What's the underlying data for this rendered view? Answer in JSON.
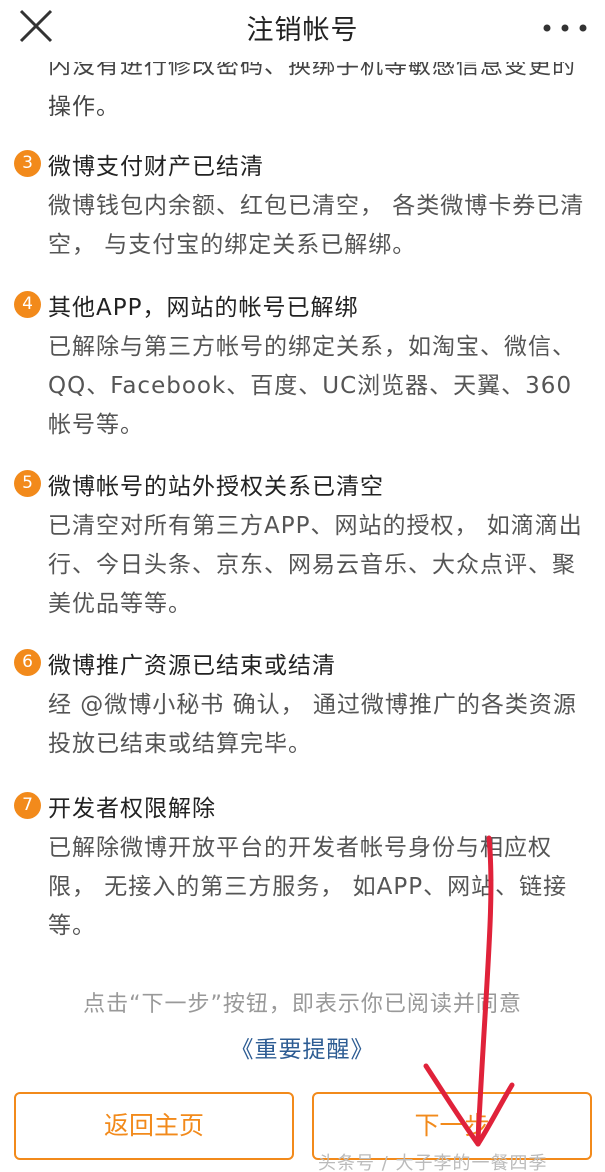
{
  "header": {
    "title": "注销帐号",
    "close_icon": "close-icon",
    "more_icon": "more-dots-icon"
  },
  "partial_text": {
    "line1": "内没有进行修改密码、换绑手机等敏感信息变更的",
    "line2": "操作。"
  },
  "items": [
    {
      "num": "3",
      "title": "微博支付财产已结清",
      "desc": "微博钱包内余额、红包已清空， 各类微博卡券已清空， 与支付宝的绑定关系已解绑。"
    },
    {
      "num": "4",
      "title": "其他APP，网站的帐号已解绑",
      "desc": "已解除与第三方帐号的绑定关系，如淘宝、微信、QQ、Facebook、百度、UC浏览器、天翼、360帐号等。"
    },
    {
      "num": "5",
      "title": "微博帐号的站外授权关系已清空",
      "desc": "已清空对所有第三方APP、网站的授权， 如滴滴出行、今日头条、京东、网易云音乐、大众点评、聚美优品等等。"
    },
    {
      "num": "6",
      "title": "微博推广资源已结束或结清",
      "desc": "经 @微博小秘书 确认， 通过微博推广的各类资源投放已结束或结算完毕。"
    },
    {
      "num": "7",
      "title": "开发者权限解除",
      "desc": "已解除微博开放平台的开发者帐号身份与相应权限， 无接入的第三方服务， 如APP、网站、链接等。"
    }
  ],
  "footer": {
    "notice": "点击“下一步”按钮，即表示你已阅读并同意",
    "link": "《重要提醒》",
    "back_button": "返回主页",
    "next_button": "下一步",
    "watermark": "头条号 / 大子李的一餐四季"
  },
  "colors": {
    "accent": "#f28a1b",
    "link": "#2d5c93",
    "annotation": "#e0223a"
  }
}
